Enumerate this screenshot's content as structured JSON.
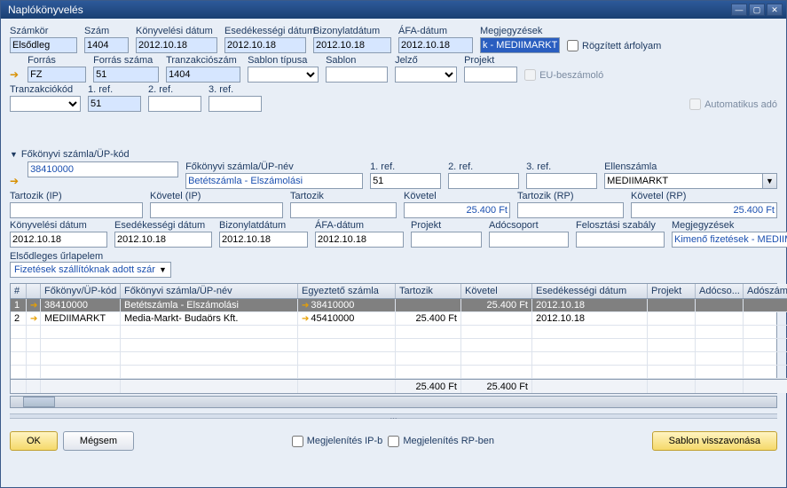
{
  "window": {
    "title": "Naplókönyvelés"
  },
  "top": {
    "labels": {
      "szamkor": "Számkör",
      "szam": "Szám",
      "konyv_datum": "Könyvelési dátum",
      "esed_datum": "Esedékességi dátum",
      "bizonylat": "Bizonylatdátum",
      "afa": "ÁFA-dátum",
      "megj": "Megjegyzések",
      "rogzitett": "Rögzített árfolyam",
      "forras": "Forrás",
      "forras_szama": "Forrás száma",
      "tranz_szam": "Tranzakciószám",
      "sablon_tipus": "Sablon típusa",
      "sablon": "Sablon",
      "jelzo": "Jelző",
      "projekt": "Projekt",
      "eu": "EU-beszámoló",
      "tranz_kod": "Tranzakciókód",
      "ref1": "1. ref.",
      "ref2": "2. ref.",
      "ref3": "3. ref.",
      "auto_ado": "Automatikus adó"
    },
    "values": {
      "szamkor": "Elsődleg",
      "szam": "1404",
      "konyv_datum": "2012.10.18",
      "esed_datum": "2012.10.18",
      "bizonylat": "2012.10.18",
      "afa": "2012.10.18",
      "megj": "k - MEDIIMARKT",
      "forras": "FZ",
      "forras_szama": "51",
      "tranz_szam": "1404",
      "ref1_val": "51"
    }
  },
  "mid": {
    "section": "Főkönyvi számla/ÜP-kód",
    "labels": {
      "fk_nev": "Főkönyvi számla/ÜP-név",
      "ref1": "1. ref.",
      "ref2": "2. ref.",
      "ref3": "3. ref.",
      "ellen": "Ellenszámla",
      "tart_ip": "Tartozik (IP)",
      "kov_ip": "Követel (IP)",
      "tart": "Tartozik",
      "kov": "Követel",
      "tart_rp": "Tartozik (RP)",
      "kov_rp": "Követel (RP)",
      "konyv_datum": "Könyvelési dátum",
      "esed_datum": "Esedékességi dátum",
      "bizonylat": "Bizonylatdátum",
      "afa": "ÁFA-dátum",
      "projekt": "Projekt",
      "adocsoport": "Adócsoport",
      "feloszt": "Felosztási szabály",
      "megj": "Megjegyzések",
      "elsod": "Elsődleges űrlapelem"
    },
    "values": {
      "fk_kod": "38410000",
      "fk_nev": "Betétszámla - Elszámolási",
      "ref1": "51",
      "ellen": "MEDIIMARKT",
      "kov": "25.400 Ft",
      "kov_rp": "25.400 Ft",
      "konyv_datum": "2012.10.18",
      "esed_datum": "2012.10.18",
      "bizonylat": "2012.10.18",
      "afa": "2012.10.18",
      "megj": "Kimenő fizetések - MEDIIMARK",
      "elsod_link": "Fizetések szállítóknak adott szár"
    }
  },
  "table": {
    "headers": {
      "idx": "#",
      "fk_kod": "Főkönyv/ÜP-kód",
      "fk_nev": "Főkönyvi számla/ÜP-név",
      "egy": "Egyeztető számla",
      "tart": "Tartozik",
      "kov": "Követel",
      "esed": "Esedékességi dátum",
      "prj": "Projekt",
      "ado": "Adócso...",
      "adsz": "Adószám"
    },
    "rows": [
      {
        "idx": "1",
        "fk_kod": "38410000",
        "fk_nev": "Betétszámla - Elszámolási",
        "egy": "38410000",
        "tart": "",
        "kov": "25.400 Ft",
        "esed": "2012.10.18",
        "selected": true
      },
      {
        "idx": "2",
        "fk_kod": "MEDIIMARKT",
        "fk_nev": "Media-Markt- Budaörs Kft.",
        "egy": "45410000",
        "tart": "25.400 Ft",
        "kov": "",
        "esed": "2012.10.18",
        "selected": false
      }
    ],
    "footer": {
      "tart": "25.400 Ft",
      "kov": "25.400 Ft"
    }
  },
  "bottom": {
    "ok": "OK",
    "megsem": "Mégsem",
    "megj_ip": "Megjelenítés IP-b",
    "megj_rp": "Megjelenítés RP-ben",
    "sablon": "Sablon visszavonása"
  }
}
